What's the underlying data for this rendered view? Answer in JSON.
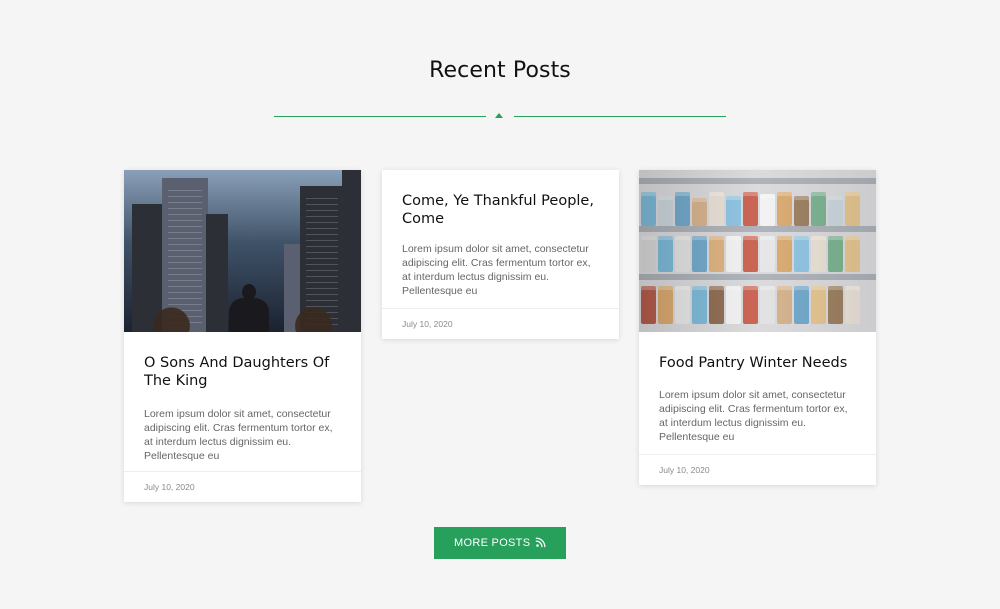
{
  "section": {
    "title": "Recent Posts"
  },
  "posts": [
    {
      "title": "O Sons And Daughters Of The King",
      "excerpt": "Lorem ipsum dolor sit amet, consectetur adipiscing elit. Cras fermentum tortor ex, at interdum lectus dignissim eu. Pellentesque eu",
      "date": "July 10, 2020",
      "image": "city-buildings"
    },
    {
      "title": "Come, Ye Thankful People, Come",
      "excerpt": "Lorem ipsum dolor sit amet, consectetur adipiscing elit. Cras fermentum tortor ex, at interdum lectus dignissim eu. Pellentesque eu",
      "date": "July 10, 2020",
      "image": null
    },
    {
      "title": "Food Pantry Winter Needs",
      "excerpt": "Lorem ipsum dolor sit amet, consectetur adipiscing elit. Cras fermentum tortor ex, at interdum lectus dignissim eu. Pellentesque eu",
      "date": "July 10, 2020",
      "image": "grocery-shelves"
    }
  ],
  "actions": {
    "more_label": "MORE POSTS",
    "more_icon": "rss-icon"
  },
  "colors": {
    "accent": "#27a05c",
    "background": "#f5f5f5",
    "card": "#ffffff"
  }
}
